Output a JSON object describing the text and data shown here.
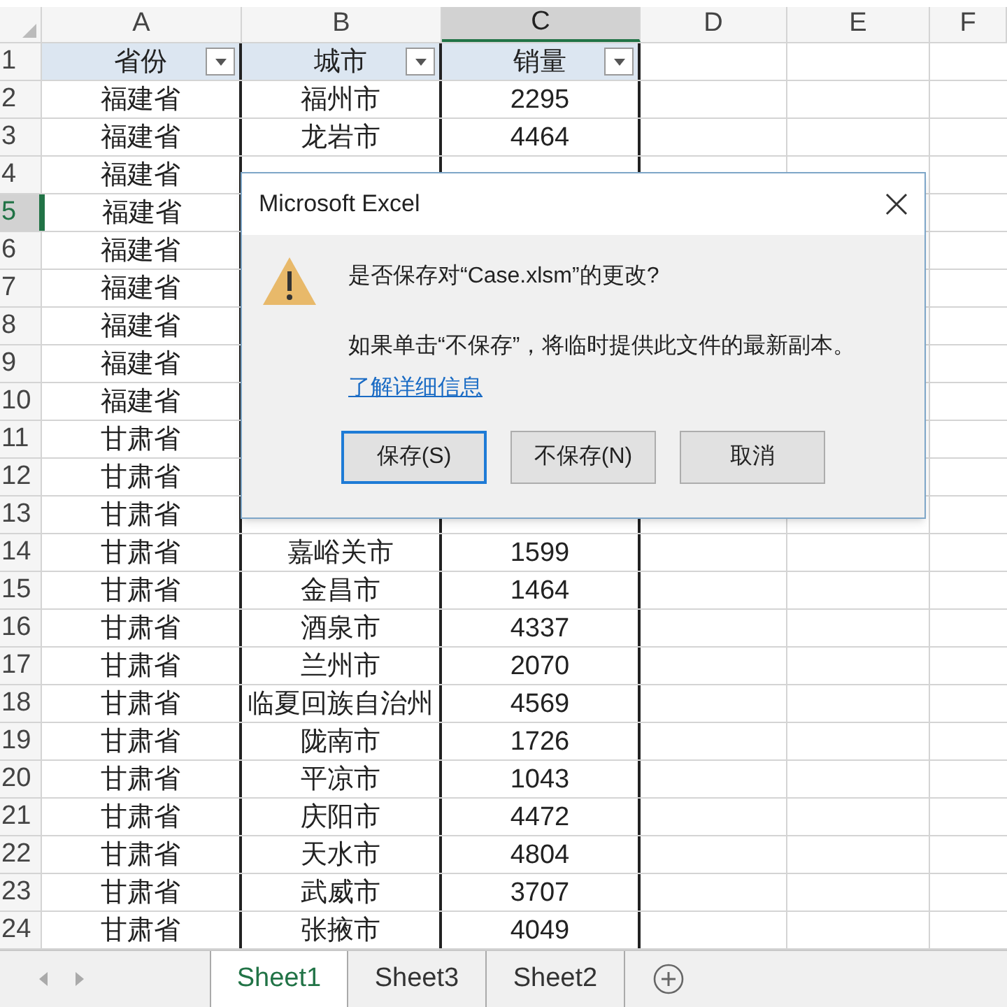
{
  "columns": [
    {
      "label": "A",
      "selected": false
    },
    {
      "label": "B",
      "selected": false
    },
    {
      "label": "C",
      "selected": true
    },
    {
      "label": "D",
      "selected": false
    },
    {
      "label": "E",
      "selected": false
    },
    {
      "label": "F",
      "selected": false
    }
  ],
  "rows": [
    {
      "number": "1",
      "selected": false,
      "kind": "header",
      "cells": [
        "省份",
        "城市",
        "销量"
      ]
    },
    {
      "number": "2",
      "selected": false,
      "kind": "data",
      "cells": [
        "福建省",
        "福州市",
        "2295"
      ]
    },
    {
      "number": "3",
      "selected": false,
      "kind": "data",
      "cells": [
        "福建省",
        "龙岩市",
        "4464"
      ]
    },
    {
      "number": "4",
      "selected": false,
      "kind": "data",
      "cells": [
        "福建省"
      ]
    },
    {
      "number": "5",
      "selected": true,
      "kind": "data",
      "cells": [
        "福建省"
      ]
    },
    {
      "number": "6",
      "selected": false,
      "kind": "data",
      "cells": [
        "福建省"
      ]
    },
    {
      "number": "7",
      "selected": false,
      "kind": "data",
      "cells": [
        "福建省"
      ]
    },
    {
      "number": "8",
      "selected": false,
      "kind": "data",
      "cells": [
        "福建省"
      ]
    },
    {
      "number": "9",
      "selected": false,
      "kind": "data",
      "cells": [
        "福建省"
      ]
    },
    {
      "number": "10",
      "selected": false,
      "kind": "data",
      "cells": [
        "福建省"
      ]
    },
    {
      "number": "11",
      "selected": false,
      "kind": "data",
      "cells": [
        "甘肃省"
      ]
    },
    {
      "number": "12",
      "selected": false,
      "kind": "data",
      "cells": [
        "甘肃省"
      ]
    },
    {
      "number": "13",
      "selected": false,
      "kind": "data",
      "cells": [
        "甘肃省"
      ]
    },
    {
      "number": "14",
      "selected": false,
      "kind": "data",
      "cells": [
        "甘肃省",
        "嘉峪关市",
        "1599"
      ]
    },
    {
      "number": "15",
      "selected": false,
      "kind": "data",
      "cells": [
        "甘肃省",
        "金昌市",
        "1464"
      ]
    },
    {
      "number": "16",
      "selected": false,
      "kind": "data",
      "cells": [
        "甘肃省",
        "酒泉市",
        "4337"
      ]
    },
    {
      "number": "17",
      "selected": false,
      "kind": "data",
      "cells": [
        "甘肃省",
        "兰州市",
        "2070"
      ]
    },
    {
      "number": "18",
      "selected": false,
      "kind": "data",
      "cells": [
        "甘肃省",
        "临夏回族自治州",
        "4569"
      ]
    },
    {
      "number": "19",
      "selected": false,
      "kind": "data",
      "cells": [
        "甘肃省",
        "陇南市",
        "1726"
      ]
    },
    {
      "number": "20",
      "selected": false,
      "kind": "data",
      "cells": [
        "甘肃省",
        "平凉市",
        "1043"
      ]
    },
    {
      "number": "21",
      "selected": false,
      "kind": "data",
      "cells": [
        "甘肃省",
        "庆阳市",
        "4472"
      ]
    },
    {
      "number": "22",
      "selected": false,
      "kind": "data",
      "cells": [
        "甘肃省",
        "天水市",
        "4804"
      ]
    },
    {
      "number": "23",
      "selected": false,
      "kind": "data",
      "cells": [
        "甘肃省",
        "武威市",
        "3707"
      ]
    },
    {
      "number": "24",
      "selected": false,
      "kind": "data",
      "cells": [
        "甘肃省",
        "张掖市",
        "4049"
      ]
    }
  ],
  "sheet_tabs": [
    {
      "label": "Sheet1",
      "selected": true
    },
    {
      "label": "Sheet3",
      "selected": false
    },
    {
      "label": "Sheet2",
      "selected": false
    }
  ],
  "dialog": {
    "title": "Microsoft Excel",
    "question": "是否保存对“Case.xlsm”的更改?",
    "message": "如果单击“不保存”，将临时提供此文件的最新副本。",
    "link": "了解详细信息",
    "buttons": [
      {
        "label": "保存(S)",
        "selected": true
      },
      {
        "label": "不保存(N)",
        "selected": false
      },
      {
        "label": "取消",
        "selected": false
      }
    ]
  }
}
